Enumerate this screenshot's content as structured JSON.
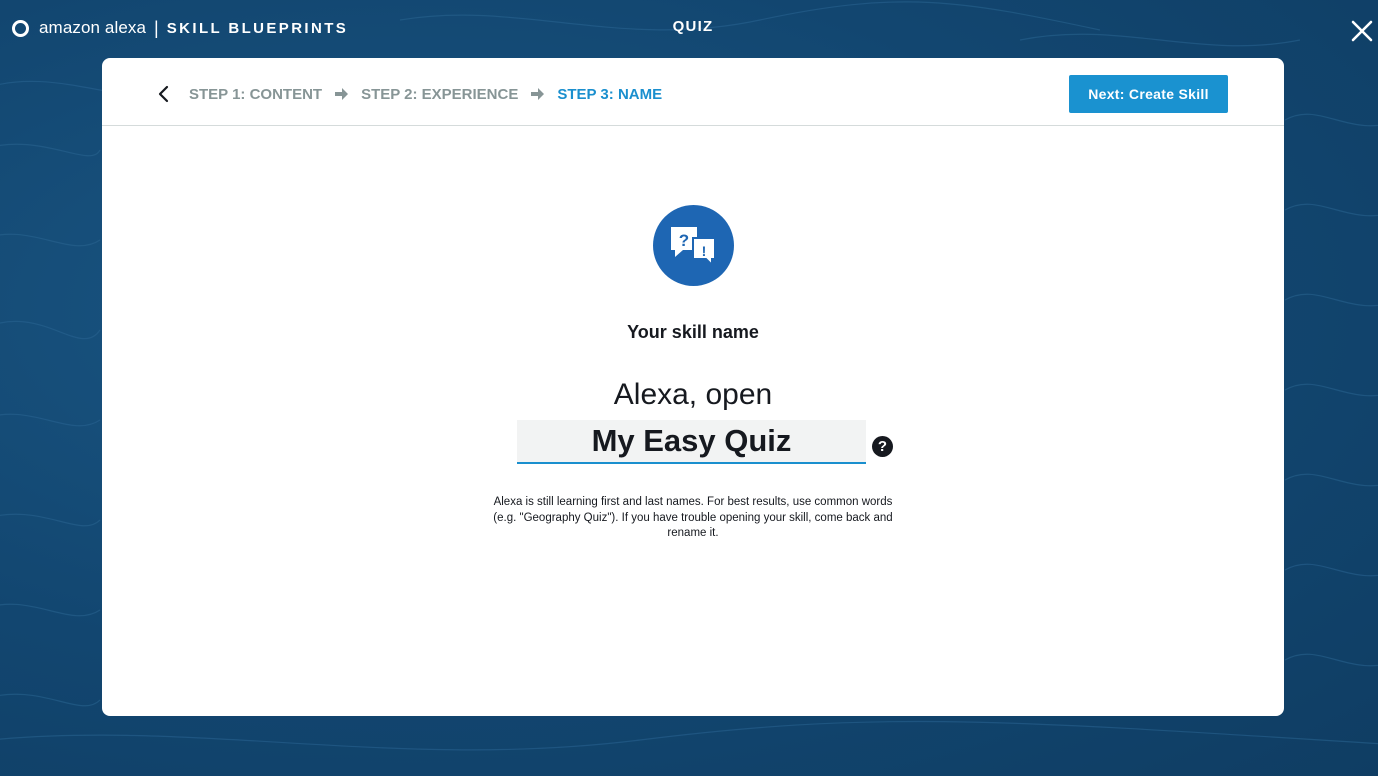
{
  "brand": {
    "logo": "alexa-ring-icon",
    "name": "amazon alexa",
    "separator": "|",
    "product": "SKILL BLUEPRINTS"
  },
  "topbar": {
    "title": "QUIZ",
    "close_icon": "close-x-icon"
  },
  "steps": [
    {
      "label": "STEP 1: CONTENT",
      "active": false
    },
    {
      "label": "STEP 2: EXPERIENCE",
      "active": false
    },
    {
      "label": "STEP 3: NAME",
      "active": true
    }
  ],
  "nav": {
    "back_icon": "chevron-left-icon",
    "step_separator_icon": "arrow-right-icon",
    "next_label": "Next: Create Skill"
  },
  "content": {
    "icon": "quiz-question-exclamation-icon",
    "heading": "Your skill name",
    "invocation_prefix": "Alexa, open",
    "skill_name_value": "My Easy Quiz",
    "help_icon": "question-circle-icon",
    "help_glyph": "?",
    "hint": "Alexa is still learning first and last names. For best results, use common words (e.g. \"Geography Quiz\"). If you have trouble opening your skill, come back and rename it."
  },
  "colors": {
    "background": "#13486f",
    "accent": "#1a92d0",
    "active_step": "#1a8fce",
    "inactive_step": "#879596",
    "icon_circle": "#1e66b3",
    "card": "#ffffff"
  }
}
